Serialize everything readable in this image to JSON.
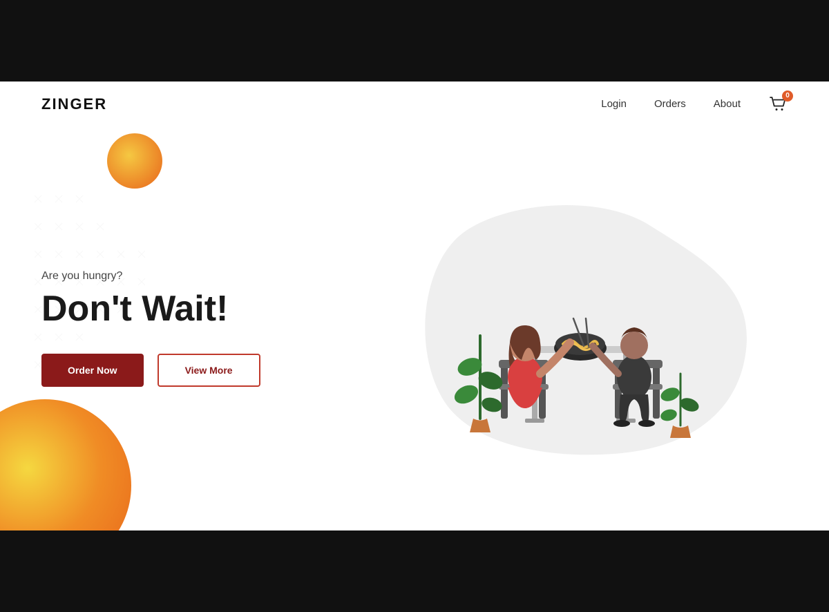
{
  "brand": {
    "logo": "ZINGER"
  },
  "navbar": {
    "login_label": "Login",
    "orders_label": "Orders",
    "about_label": "About",
    "cart_count": "0"
  },
  "hero": {
    "subtitle": "Are you hungry?",
    "title": "Don't Wait!",
    "order_now_label": "Order Now",
    "view_more_label": "View More"
  },
  "colors": {
    "dark_red": "#8b1a1a",
    "orange_gradient_start": "#f5c842",
    "orange_gradient_end": "#e8641a",
    "badge_color": "#e05c2a"
  }
}
